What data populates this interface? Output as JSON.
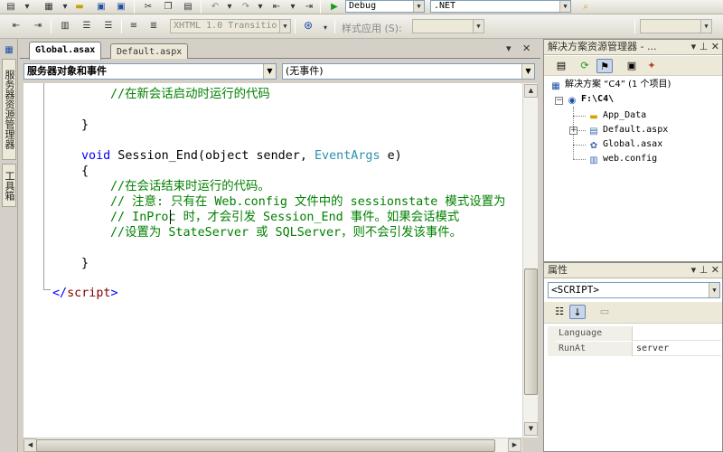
{
  "toolbar": {
    "debug_config": "Debug",
    "platform": ".NET",
    "doctype": "XHTML 1.0 Transitio",
    "style_apply_label": "样式应用 (S):",
    "style_apply_value": ""
  },
  "left_strip": {
    "server_explorer": "服务器资源管理器",
    "toolbox": "工具箱"
  },
  "document": {
    "tabs": [
      {
        "label": "Global.asax",
        "active": true
      },
      {
        "label": "Default.aspx",
        "active": false
      }
    ],
    "object_dropdown": "服务器对象和事件",
    "event_dropdown": "(无事件)",
    "code": {
      "comment_start": "//在新会话启动时运行的代码",
      "brace_close_1": "}",
      "void_kw": "void",
      "method_sig_1": " Session_End(object sender, ",
      "event_args_type": "EventArgs",
      "method_sig_2": " e)",
      "brace_open": "{",
      "comment_1": "//在会话结束时运行的代码。",
      "comment_2": "// 注意: 只有在 Web.config 文件中的 sessionstate 模式设置为",
      "comment_3": "// InProc 时，才会引发 Session_End 事件。如果会话模式",
      "comment_4": "//设置为 StateServer 或 SQLServer，则不会引发该事件。",
      "brace_close_2": "}",
      "script_open": "</",
      "script_tag": "script",
      "script_close": ">"
    }
  },
  "solution_explorer": {
    "title": "解决方案资源管理器 - ...",
    "solution": "解决方案 “C4” (1 个项目)",
    "project": "F:\\C4\\",
    "items": [
      {
        "label": "App_Data",
        "icon": "folder-icon"
      },
      {
        "label": "Default.aspx",
        "icon": "aspx-file-icon"
      },
      {
        "label": "Global.asax",
        "icon": "asax-file-icon"
      },
      {
        "label": "web.config",
        "icon": "config-file-icon"
      }
    ]
  },
  "properties": {
    "title": "属性",
    "object": "<SCRIPT>",
    "rows": [
      {
        "name": "Language",
        "value": ""
      },
      {
        "name": "RunAt",
        "value": "server"
      }
    ]
  }
}
